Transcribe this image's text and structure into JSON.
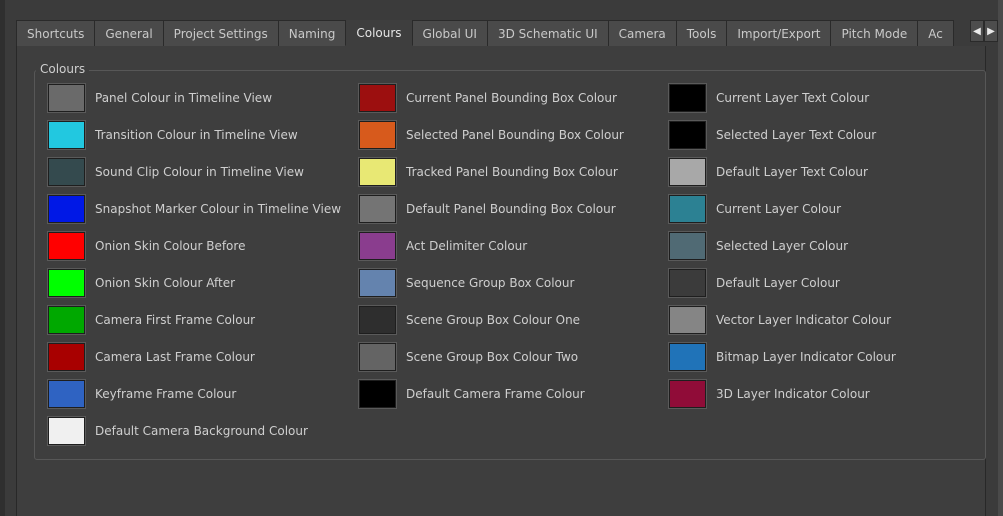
{
  "tabs": [
    {
      "label": "Shortcuts",
      "active": false
    },
    {
      "label": "General",
      "active": false
    },
    {
      "label": "Project Settings",
      "active": false
    },
    {
      "label": "Naming",
      "active": false
    },
    {
      "label": "Colours",
      "active": true
    },
    {
      "label": "Global UI",
      "active": false
    },
    {
      "label": "3D Schematic UI",
      "active": false
    },
    {
      "label": "Camera",
      "active": false
    },
    {
      "label": "Tools",
      "active": false
    },
    {
      "label": "Import/Export",
      "active": false
    },
    {
      "label": "Pitch Mode",
      "active": false
    },
    {
      "label": "Ac",
      "active": false
    }
  ],
  "tab_scroll": {
    "left_icon": "chevron-left-icon",
    "right_icon": "chevron-right-icon"
  },
  "group_title": "Colours",
  "columns": [
    [
      {
        "label": "Panel Colour in Timeline View",
        "color": "#6a6a6a"
      },
      {
        "label": "Transition Colour in Timeline View",
        "color": "#22c8e0"
      },
      {
        "label": "Sound Clip Colour in Timeline View",
        "color": "#344a4e"
      },
      {
        "label": "Snapshot Marker Colour in Timeline View",
        "color": "#0018e6"
      },
      {
        "label": "Onion Skin Colour Before",
        "color": "#ff0000"
      },
      {
        "label": "Onion Skin Colour After",
        "color": "#00ff00"
      },
      {
        "label": "Camera First Frame Colour",
        "color": "#00a800"
      },
      {
        "label": "Camera Last Frame Colour",
        "color": "#a80000"
      },
      {
        "label": "Keyframe Frame Colour",
        "color": "#2f63c2"
      },
      {
        "label": "Default Camera Background Colour",
        "color": "#f0f0f0"
      }
    ],
    [
      {
        "label": "Current Panel Bounding Box Colour",
        "color": "#9c0f0f"
      },
      {
        "label": "Selected Panel Bounding Box Colour",
        "color": "#d75a1c"
      },
      {
        "label": "Tracked Panel Bounding Box Colour",
        "color": "#e8e874"
      },
      {
        "label": "Default Panel Bounding Box Colour",
        "color": "#747474"
      },
      {
        "label": "Act Delimiter Colour",
        "color": "#8a3d8e"
      },
      {
        "label": "Sequence Group Box Colour",
        "color": "#6483ae"
      },
      {
        "label": "Scene Group Box Colour One",
        "color": "#2e2e2e"
      },
      {
        "label": "Scene Group Box Colour Two",
        "color": "#646464"
      },
      {
        "label": "Default Camera Frame Colour",
        "color": "#000000"
      }
    ],
    [
      {
        "label": "Current Layer Text Colour",
        "color": "#000000"
      },
      {
        "label": "Selected Layer Text Colour",
        "color": "#000000"
      },
      {
        "label": "Default Layer Text Colour",
        "color": "#a8a8a8"
      },
      {
        "label": "Current Layer Colour",
        "color": "#2c8193"
      },
      {
        "label": "Selected Layer Colour",
        "color": "#506a74"
      },
      {
        "label": "Default Layer Colour",
        "color": "#3b3b3b"
      },
      {
        "label": "Vector Layer Indicator Colour",
        "color": "#858585"
      },
      {
        "label": "Bitmap Layer Indicator Colour",
        "color": "#2073b8"
      },
      {
        "label": "3D Layer Indicator Colour",
        "color": "#900c38"
      }
    ]
  ]
}
